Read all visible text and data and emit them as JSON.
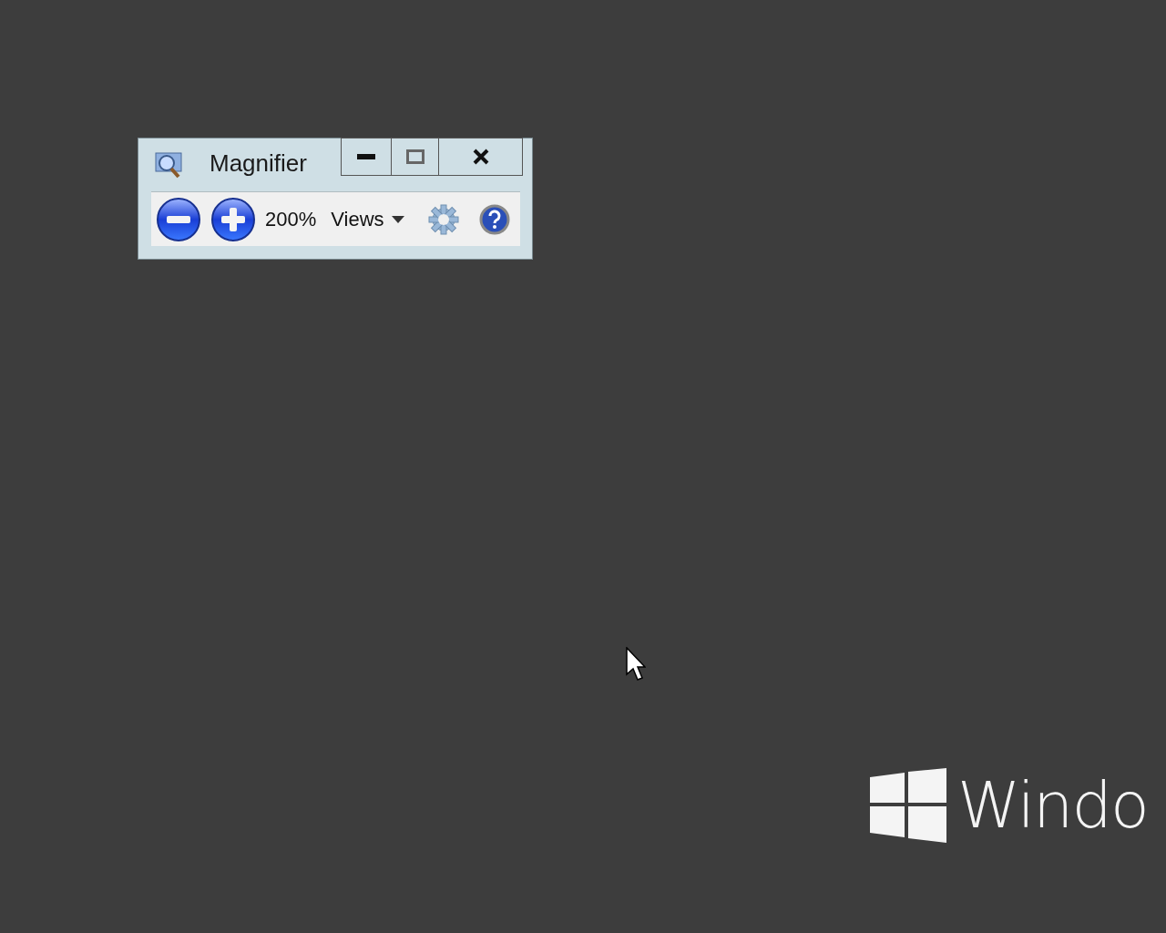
{
  "window": {
    "title": "Magnifier"
  },
  "toolbar": {
    "zoom_level": "200%",
    "views_label": "Views"
  },
  "wallpaper": {
    "logo_text": "Windo"
  }
}
